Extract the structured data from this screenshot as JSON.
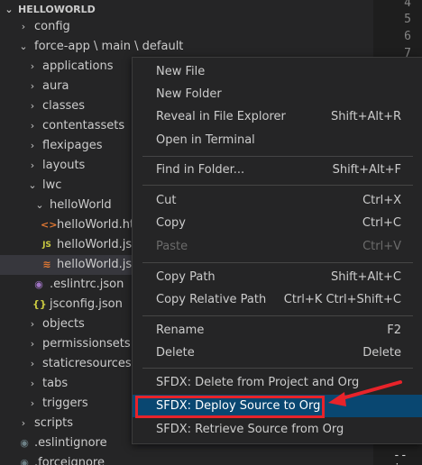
{
  "explorer": {
    "section_title": "HELLOWORLD",
    "items": [
      {
        "label": "config",
        "chevron": "›"
      },
      {
        "label": "force-app \\ main \\ default",
        "chevron": "⌄"
      },
      {
        "label": "applications",
        "chevron": "›"
      },
      {
        "label": "aura",
        "chevron": "›"
      },
      {
        "label": "classes",
        "chevron": "›"
      },
      {
        "label": "contentassets",
        "chevron": "›"
      },
      {
        "label": "flexipages",
        "chevron": "›"
      },
      {
        "label": "layouts",
        "chevron": "›"
      },
      {
        "label": "lwc",
        "chevron": "⌄"
      },
      {
        "label": "helloWorld",
        "chevron": "⌄"
      },
      {
        "label": "helloWorld.html",
        "icon": "<>",
        "icon_color": "#e37933"
      },
      {
        "label": "helloWorld.js",
        "icon": "JS",
        "icon_color": "#cbcb41"
      },
      {
        "label": "helloWorld.js-meta.xml",
        "icon": "≋",
        "icon_color": "#e37933"
      },
      {
        "label": ".eslintrc.json",
        "icon": "◉",
        "icon_color": "#a074c4"
      },
      {
        "label": "jsconfig.json",
        "icon": "{}",
        "icon_color": "#cbcb41"
      },
      {
        "label": "objects",
        "chevron": "›"
      },
      {
        "label": "permissionsets",
        "chevron": "›"
      },
      {
        "label": "staticresources",
        "chevron": "›"
      },
      {
        "label": "tabs",
        "chevron": "›"
      },
      {
        "label": "triggers",
        "chevron": "›"
      },
      {
        "label": "scripts",
        "chevron": "›"
      },
      {
        "label": ".eslintignore",
        "icon": "◉",
        "icon_color": "#6d8086"
      },
      {
        "label": ".forceignore",
        "icon": "◉",
        "icon_color": "#6d8086"
      }
    ]
  },
  "editor": {
    "line_numbers": [
      "4",
      "5",
      "6",
      "7"
    ],
    "tail_text": "--jso"
  },
  "context_menu": {
    "items": [
      {
        "label": "New File",
        "shortcut": ""
      },
      {
        "label": "New Folder",
        "shortcut": ""
      },
      {
        "label": "Reveal in File Explorer",
        "shortcut": "Shift+Alt+R"
      },
      {
        "label": "Open in Terminal",
        "shortcut": ""
      },
      {
        "label": "Find in Folder...",
        "shortcut": "Shift+Alt+F"
      },
      {
        "label": "Cut",
        "shortcut": "Ctrl+X"
      },
      {
        "label": "Copy",
        "shortcut": "Ctrl+C"
      },
      {
        "label": "Paste",
        "shortcut": "Ctrl+V"
      },
      {
        "label": "Copy Path",
        "shortcut": "Shift+Alt+C"
      },
      {
        "label": "Copy Relative Path",
        "shortcut": "Ctrl+K Ctrl+Shift+C"
      },
      {
        "label": "Rename",
        "shortcut": "F2"
      },
      {
        "label": "Delete",
        "shortcut": "Delete"
      },
      {
        "label": "SFDX: Delete from Project and Org",
        "shortcut": ""
      },
      {
        "label": "SFDX: Deploy Source to Org",
        "shortcut": ""
      },
      {
        "label": "SFDX: Retrieve Source from Org",
        "shortcut": ""
      }
    ]
  },
  "colors": {
    "sidebar_bg": "#252526",
    "editor_bg": "#1e1e1e",
    "menu_active_bg": "#094771",
    "selected_row_bg": "#37373d",
    "annotation_red": "#e8232a"
  }
}
